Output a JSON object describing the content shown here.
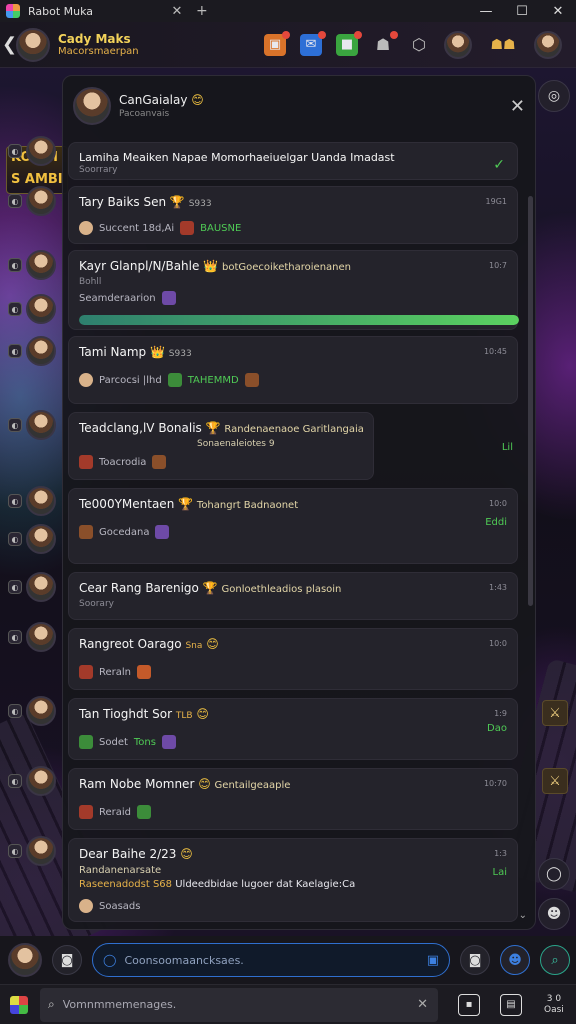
{
  "window": {
    "tab_title": "Rabot Muka",
    "close_glyph": "✕",
    "new_tab_glyph": "+",
    "min_glyph": "—",
    "max_glyph": "☐",
    "close_win_glyph": "✕"
  },
  "header": {
    "name": "Cady Maks",
    "subtitle": "Macorsmaerpan",
    "back_glyph": "❮"
  },
  "banner": {
    "line1": "KODDI",
    "line2": "S AMBI"
  },
  "panel": {
    "title": "CanGaialay",
    "title_emoji": "😊",
    "subtitle": "Pacoanvais",
    "close_glyph": "✕"
  },
  "cards": [
    {
      "title": "Lamiha Meaiken Napae Momorhaeiuelgar Uanda Imadast",
      "sub": "Soorrary",
      "check": "✓"
    },
    {
      "title": "Tary Baiks Sen",
      "emoji": "🏆",
      "extra": "S933",
      "time": "19G1",
      "meta": "Succent 18d,Ai",
      "meta_green": "BAUSNE"
    },
    {
      "title": "Kayr Glanpl/N/Bahle",
      "emoji": "👑",
      "extra": "botGoecoiketharoienanen",
      "sub": "Bohll",
      "time": "10:7",
      "meta": "Seamderaarion",
      "progress": 1.0
    },
    {
      "title": "Tami Namp",
      "emoji": "👑",
      "extra": "S933",
      "time": "10:45",
      "meta": "Parcocsi |lhd",
      "meta_green": "TAHEMMD"
    },
    {
      "title": "Teadclang,lV Bonalis",
      "emoji": "🏆",
      "extra": "Randenaenaoe Garitlangaia",
      "sub": "Sonaenaleiotes 9",
      "meta": "Toacrodia",
      "green": "Lil"
    },
    {
      "title": "Te000YMentaen",
      "emoji": "🏆",
      "extra": "Tohangrt Badnaonet",
      "time": "10:0",
      "meta": "Gocedana",
      "green": "Eddi"
    },
    {
      "title": "Cear Rang Barenigo",
      "emoji": "🏆",
      "extra": "Gonloethleadios plasoin",
      "sub": "Soorary",
      "time": "1:43"
    },
    {
      "title": "Rangreot Oarago",
      "emoji": "😊",
      "extra": "Sna",
      "time": "10:0",
      "meta": "Reraln"
    },
    {
      "title": "Tan Tioghdt Sor",
      "emoji": "😊",
      "extra": "TLB",
      "time": "1:9",
      "meta": "Sodet",
      "meta_green": "Tons",
      "green": "Dao"
    },
    {
      "title": "Ram Nobe Momner",
      "emoji": "😊",
      "extra": "Gentailgeaaple",
      "time": "10:70",
      "meta": "Reraid",
      "green": ""
    },
    {
      "title": "Dear Baihe 2/23",
      "emoji": "😊",
      "line2": "Randanenarsate",
      "line3": "Raseenadodst S68",
      "line3_extra": "Uldeedbidae lugoer dat Kaelagie:Ca",
      "time": "1:3",
      "green": "Lai",
      "meta": "Soasads"
    }
  ],
  "composer": {
    "placeholder": "Coonsoomaancksaes.",
    "search_glyph": "◯"
  },
  "taskbar": {
    "search_placeholder": "Vomnmmemenages.",
    "clock": "3 0\nOasi"
  },
  "colors": {
    "accent_blue": "#2f6fcf",
    "accent_green": "#4fca55",
    "highlight_gold": "#f2d25a"
  }
}
